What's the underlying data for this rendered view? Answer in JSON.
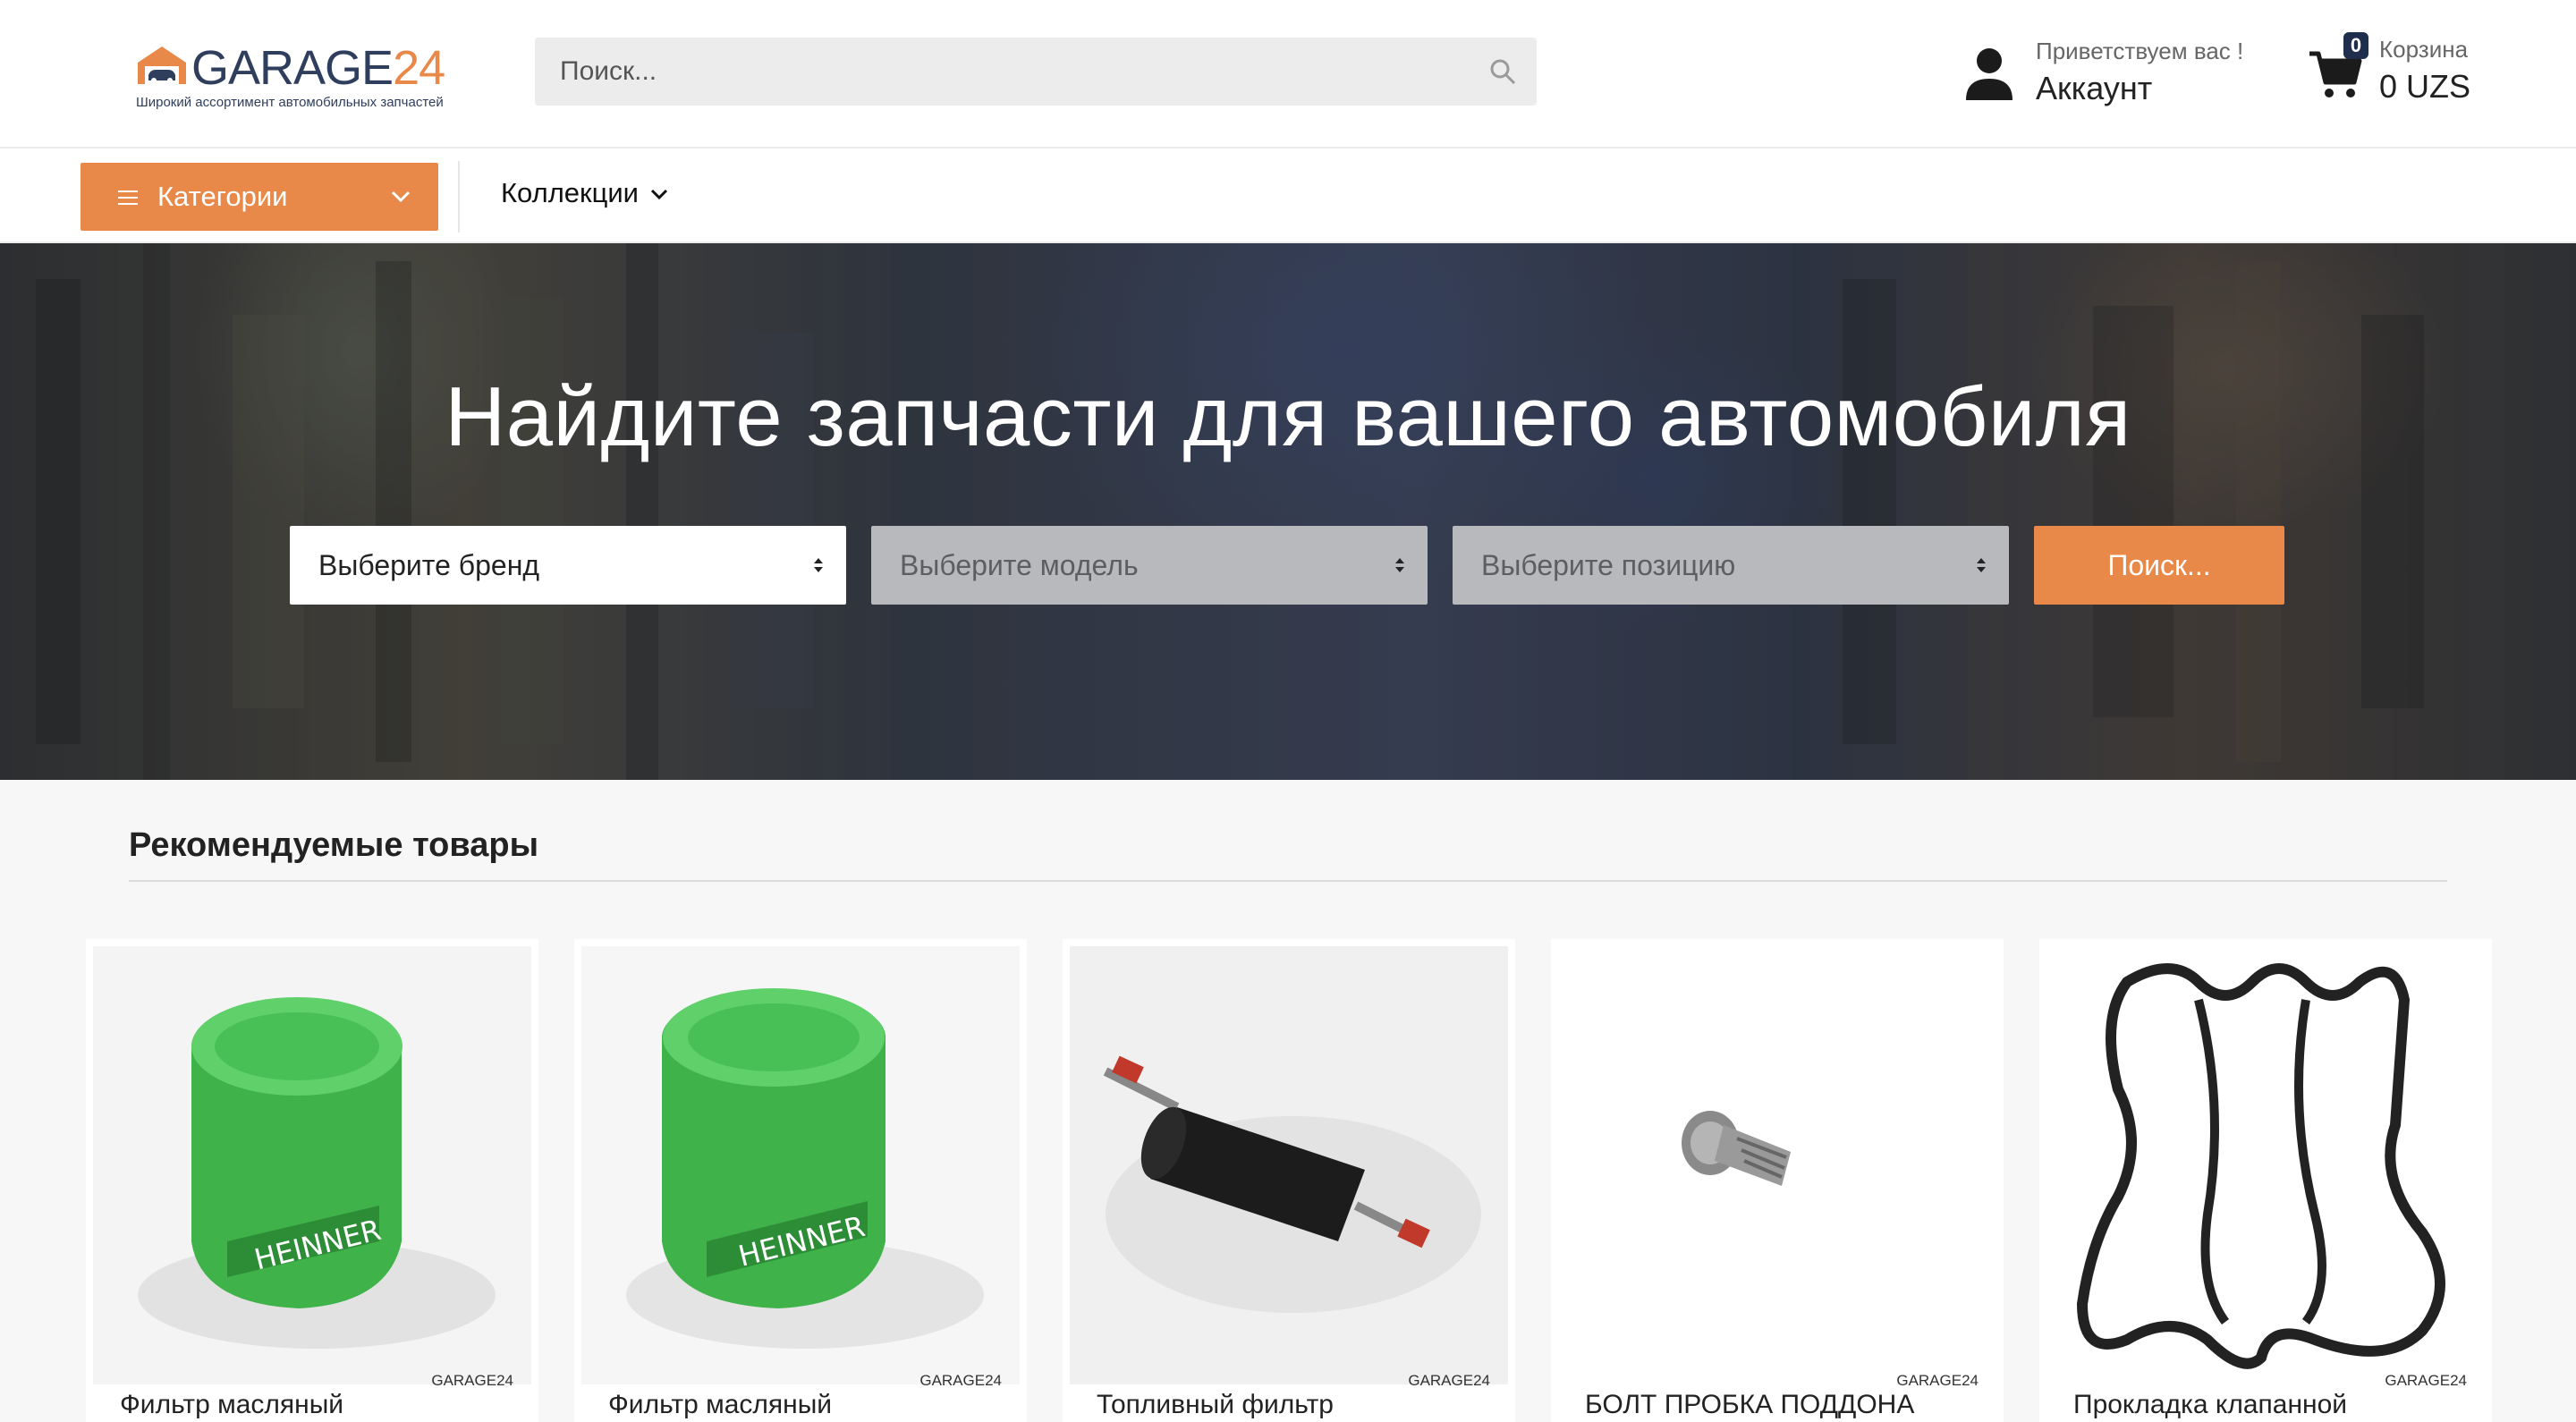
{
  "header": {
    "logo_text": "GARAGE",
    "logo_num": "24",
    "logo_tagline": "Широкий ассортимент автомобильных запчастей",
    "search_placeholder": "Поиск...",
    "account_greeting": "Приветствуем вас !",
    "account_label": "Аккаунт",
    "cart_label": "Корзина",
    "cart_count": "0",
    "cart_total": "0 UZS"
  },
  "nav": {
    "categories_label": "Категории",
    "collections_label": "Коллекции"
  },
  "hero": {
    "title": "Найдите запчасти для вашего автомобиля",
    "brand_select": "Выберите бренд",
    "model_select": "Выберите модель",
    "position_select": "Выберите позицию",
    "search_button": "Поиск..."
  },
  "recommended": {
    "title": "Рекомендуемые товары",
    "watermark": "GARAGE24",
    "products": [
      {
        "name": "Фильтр масляный"
      },
      {
        "name": "Фильтр масляный"
      },
      {
        "name": "Топливный фильтр"
      },
      {
        "name": "БОЛТ ПРОБКА ПОДДОНА"
      },
      {
        "name": "Прокладка клапанной"
      }
    ]
  },
  "colors": {
    "accent": "#e8894a",
    "navy": "#2f3e5c",
    "badge": "#1f2e4d"
  }
}
